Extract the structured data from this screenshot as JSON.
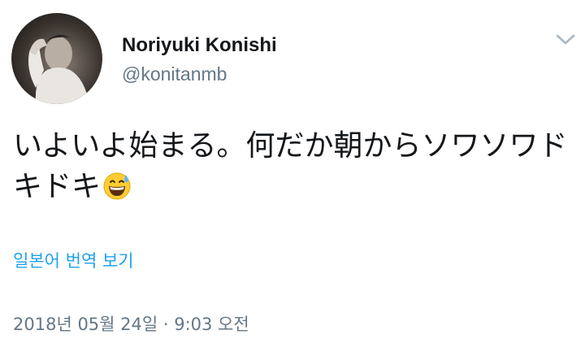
{
  "author": {
    "name": "Noriyuki Konishi",
    "handle": "@konitanmb",
    "avatar_icon": "profile-photo"
  },
  "menu": {
    "icon": "chevron-down-icon",
    "color": "#aab8c2"
  },
  "tweet": {
    "text": "いよいよ始まる。何だか朝からソワソワドキドキ",
    "emoji": "grinning-face-with-sweat",
    "translate_label": "일본어 번역 보기",
    "timestamp": "2018년 05월 24일 · 9:03 오전"
  },
  "colors": {
    "text": "#14171a",
    "secondary": "#657786",
    "link": "#1da1f2"
  }
}
